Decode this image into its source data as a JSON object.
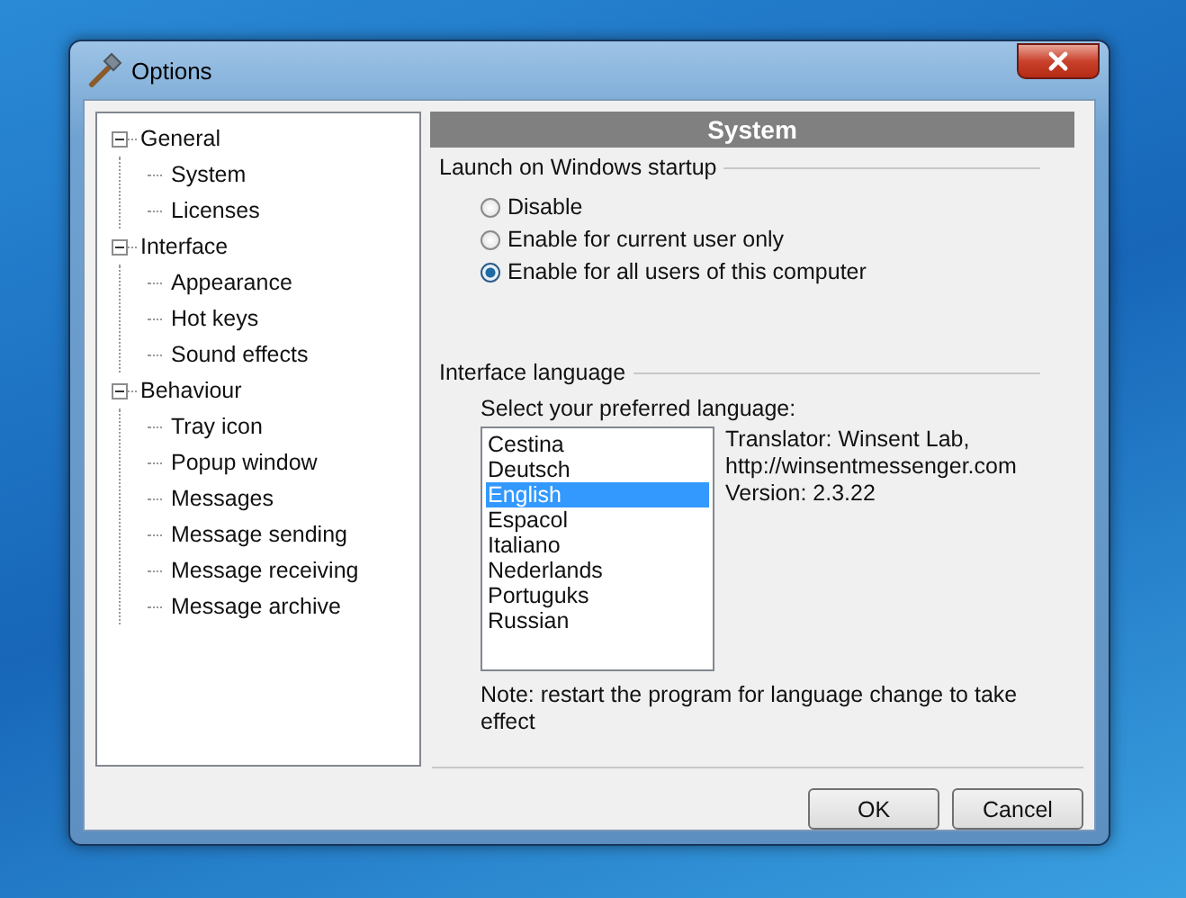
{
  "window": {
    "title": "Options"
  },
  "tree": [
    {
      "label": "General",
      "expanded": true,
      "children": [
        {
          "label": "System"
        },
        {
          "label": "Licenses"
        }
      ]
    },
    {
      "label": "Interface",
      "expanded": true,
      "children": [
        {
          "label": "Appearance"
        },
        {
          "label": "Hot keys"
        },
        {
          "label": "Sound effects"
        }
      ]
    },
    {
      "label": "Behaviour",
      "expanded": true,
      "children": [
        {
          "label": "Tray icon"
        },
        {
          "label": "Popup window"
        },
        {
          "label": "Messages"
        },
        {
          "label": "Message sending"
        },
        {
          "label": "Message receiving"
        },
        {
          "label": "Message archive"
        }
      ]
    }
  ],
  "panel": {
    "header": "System",
    "startup": {
      "title": "Launch on Windows startup",
      "options": [
        {
          "label": "Disable",
          "selected": false
        },
        {
          "label": "Enable for current user only",
          "selected": false
        },
        {
          "label": "Enable for all users of this computer",
          "selected": true
        }
      ]
    },
    "language": {
      "title": "Interface language",
      "prompt": "Select your preferred language:",
      "items": [
        {
          "label": "Cestina",
          "selected": false
        },
        {
          "label": "Deutsch",
          "selected": false
        },
        {
          "label": "English",
          "selected": true
        },
        {
          "label": "Espacol",
          "selected": false
        },
        {
          "label": "Italiano",
          "selected": false
        },
        {
          "label": "Nederlands",
          "selected": false
        },
        {
          "label": "Portuguks",
          "selected": false
        },
        {
          "label": "Russian",
          "selected": false
        }
      ],
      "info": [
        "Translator: Winsent Lab,",
        "http://winsentmessenger.com",
        "Version: 2.3.22"
      ],
      "note": "Note: restart the program for language change to take effect"
    }
  },
  "buttons": [
    "OK",
    "Cancel"
  ]
}
